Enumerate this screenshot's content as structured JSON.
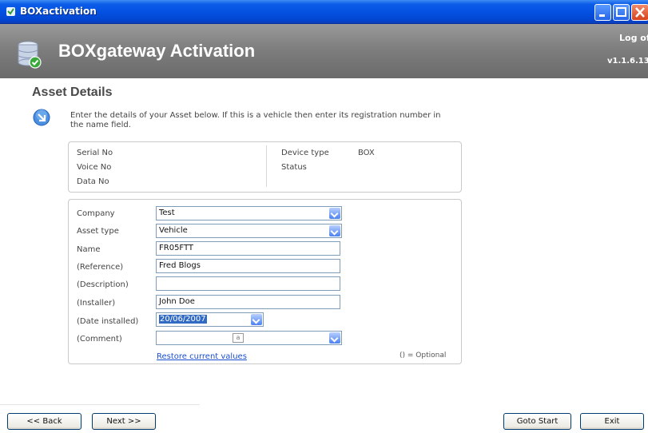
{
  "window": {
    "title": "BOXactivation"
  },
  "header": {
    "title": "BOXgateway Activation",
    "logoff": "Log off",
    "version": "v1.1.6.13"
  },
  "section": {
    "title": "Asset Details",
    "instructions": "Enter the details of your Asset below. If this is a vehicle then enter its registration number in the name field."
  },
  "info": {
    "serial_label": "Serial No",
    "voice_label": "Voice No",
    "data_label": "Data No",
    "device_type_label": "Device type",
    "device_type_value": "BOX",
    "status_label": "Status"
  },
  "form": {
    "company": {
      "label": "Company",
      "value": "Test"
    },
    "asset_type": {
      "label": "Asset type",
      "value": "Vehicle"
    },
    "name": {
      "label": "Name",
      "value": "FR05FTT"
    },
    "reference": {
      "label": "(Reference)",
      "value": "Fred Blogs"
    },
    "description": {
      "label": "(Description)",
      "value": ""
    },
    "installer": {
      "label": "(Installer)",
      "value": "John Doe"
    },
    "date_installed": {
      "label": "(Date installed)",
      "value": "20/06/2007"
    },
    "comment": {
      "label": "(Comment)",
      "value": "",
      "glyph": "a"
    },
    "restore_link": "Restore current values",
    "optional_note": "() = Optional"
  },
  "buttons": {
    "back": "<< Back",
    "next": "Next >>",
    "goto_start": "Goto Start",
    "exit": "Exit"
  },
  "colors": {
    "titlebar": "#0450e0",
    "header_band": "#7e7e7e",
    "link": "#1a4fd0",
    "selection": "#316ac5"
  },
  "icons": {
    "title": "app-icon",
    "header": "database-check-icon",
    "instructions": "arrow-down-right-icon"
  }
}
